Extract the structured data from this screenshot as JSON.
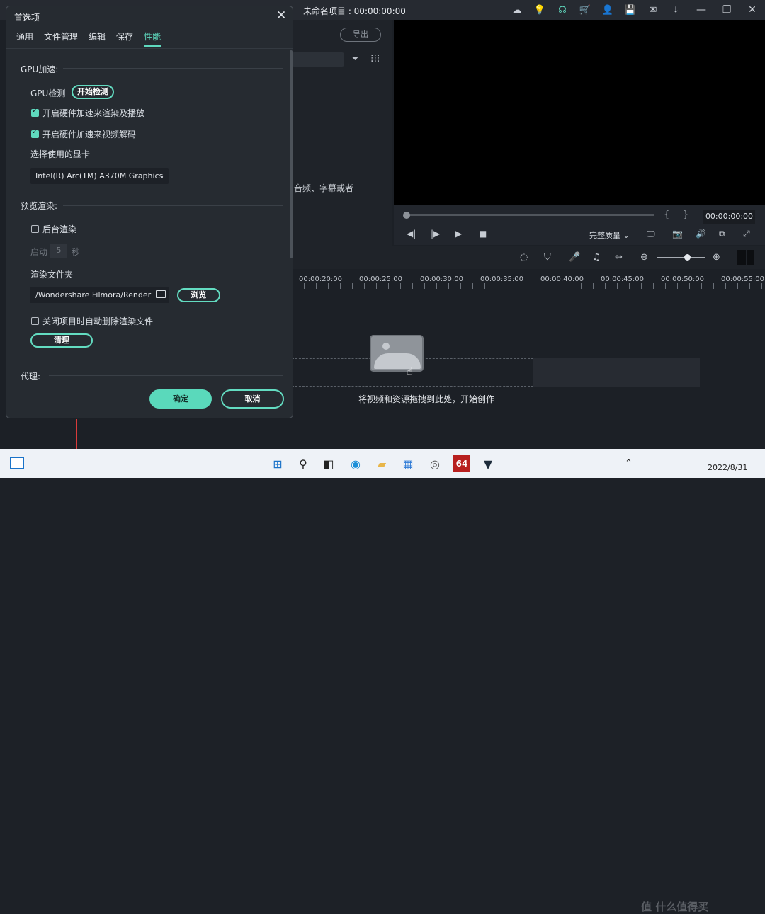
{
  "app": {
    "title": "未命名项目 : 00:00:00:00",
    "export_label": "导出",
    "drop_hint": "音频、字幕或者",
    "preview_time": "00:00:00:00",
    "brace_open": "{",
    "brace_close": "}",
    "quality_label": "完整质量",
    "track_hint": "将视频和资源拖拽到此处，开始创作",
    "ruler_ticks": [
      "00:00:20:00",
      "00:00:25:00",
      "00:00:30:00",
      "00:00:35:00",
      "00:00:40:00",
      "00:00:45:00",
      "00:00:50:00",
      "00:00:55:00"
    ]
  },
  "dialog": {
    "title": "首选项",
    "tabs": [
      "通用",
      "文件管理",
      "编辑",
      "保存",
      "性能"
    ],
    "active_tab": "性能",
    "gpu_section": "GPU加速:",
    "gpu_detect_label": "GPU检测",
    "gpu_detect_button": "开始检测",
    "hw_render_label": "开启硬件加速来渲染及播放",
    "hw_decode_label": "开启硬件加速来视频解码",
    "gpu_select_label": "选择使用的显卡",
    "gpu_select_value": "Intel(R) Arc(TM) A370M Graphics",
    "preview_section": "预览渲染:",
    "bg_render_label": "后台渲染",
    "start_label": "启动",
    "start_value": "5",
    "seconds_label": "秒",
    "render_folder_label": "渲染文件夹",
    "render_folder_value": "/Wondershare Filmora/Render",
    "browse_button": "浏览",
    "auto_delete_label": "关闭项目时自动删除渲染文件",
    "clean_button": "清理",
    "proxy_section": "代理:",
    "ok_button": "确定",
    "cancel_button": "取消",
    "checkboxes": {
      "hw_render": true,
      "hw_decode": true,
      "bg_render": false,
      "auto_delete": false
    }
  },
  "taskbar": {
    "badge_64": "64",
    "date": "2022/8/31",
    "watermark": "值 什么值得买"
  },
  "colors": {
    "accent": "#5fd9be",
    "dialog_bg": "#262b31",
    "app_bg": "#1c2026"
  }
}
